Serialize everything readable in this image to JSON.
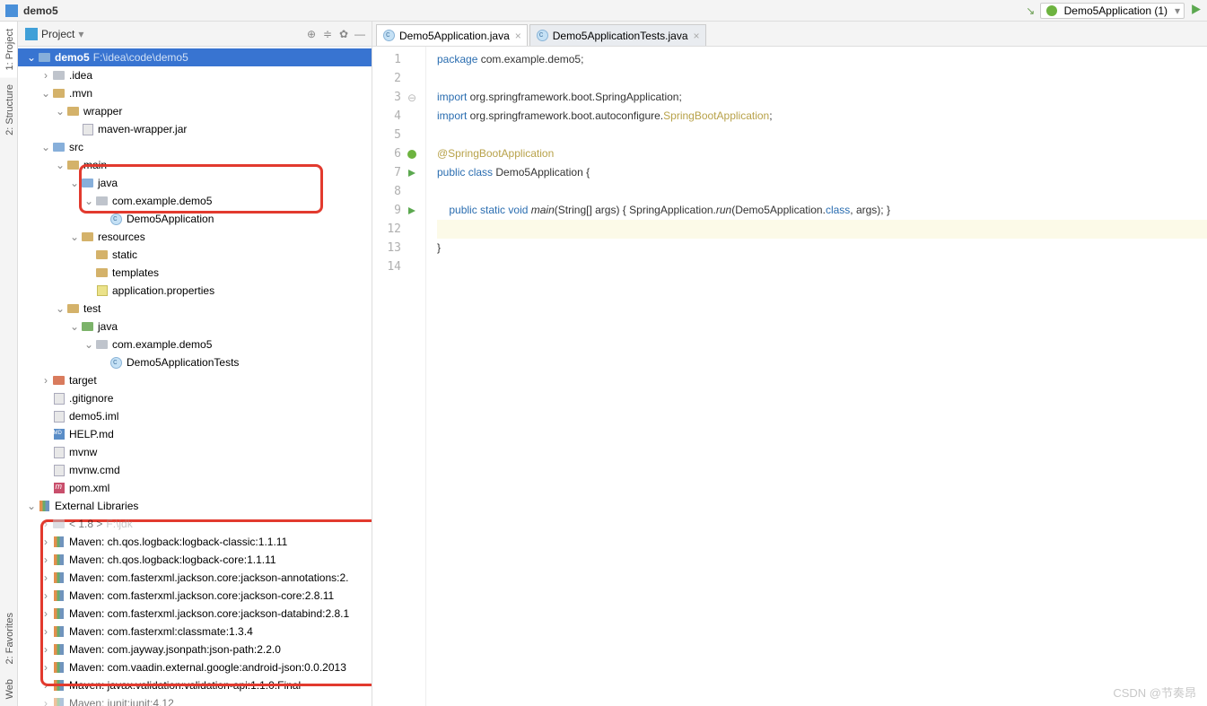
{
  "title": "demo5",
  "runConfig": "Demo5Application (1)",
  "panel": {
    "label": "Project"
  },
  "tabs": [
    {
      "label": "Demo5Application.java",
      "active": true
    },
    {
      "label": "Demo5ApplicationTests.java",
      "active": false
    }
  ],
  "sideTabs": [
    "1: Project",
    "2: Structure",
    "2: Favorites",
    "Web"
  ],
  "tree": [
    {
      "d": 0,
      "tw": "v",
      "ico": "folder-open",
      "label": "demo5",
      "suffix": "F:\\idea\\code\\demo5",
      "sel": true,
      "bold": true
    },
    {
      "d": 1,
      "tw": ">",
      "ico": "folder-grey",
      "label": ".idea"
    },
    {
      "d": 1,
      "tw": "v",
      "ico": "folder",
      "label": ".mvn"
    },
    {
      "d": 2,
      "tw": "v",
      "ico": "folder",
      "label": "wrapper"
    },
    {
      "d": 3,
      "tw": "",
      "ico": "file",
      "label": "maven-wrapper.jar"
    },
    {
      "d": 1,
      "tw": "v",
      "ico": "folder-open",
      "label": "src"
    },
    {
      "d": 2,
      "tw": "v",
      "ico": "folder",
      "label": "main"
    },
    {
      "d": 3,
      "tw": "v",
      "ico": "folder-open",
      "label": "java"
    },
    {
      "d": 4,
      "tw": "v",
      "ico": "folder-grey",
      "label": "com.example.demo5"
    },
    {
      "d": 5,
      "tw": "",
      "ico": "class",
      "label": "Demo5Application"
    },
    {
      "d": 3,
      "tw": "v",
      "ico": "folder",
      "label": "resources"
    },
    {
      "d": 4,
      "tw": "",
      "ico": "folder",
      "label": "static"
    },
    {
      "d": 4,
      "tw": "",
      "ico": "folder",
      "label": "templates"
    },
    {
      "d": 4,
      "tw": "",
      "ico": "props",
      "label": "application.properties"
    },
    {
      "d": 2,
      "tw": "v",
      "ico": "folder",
      "label": "test"
    },
    {
      "d": 3,
      "tw": "v",
      "ico": "folder-green",
      "label": "java"
    },
    {
      "d": 4,
      "tw": "v",
      "ico": "folder-grey",
      "label": "com.example.demo5"
    },
    {
      "d": 5,
      "tw": "",
      "ico": "class",
      "label": "Demo5ApplicationTests"
    },
    {
      "d": 1,
      "tw": ">",
      "ico": "folder-red",
      "label": "target"
    },
    {
      "d": 1,
      "tw": "",
      "ico": "file",
      "label": ".gitignore"
    },
    {
      "d": 1,
      "tw": "",
      "ico": "file",
      "label": "demo5.iml"
    },
    {
      "d": 1,
      "tw": "",
      "ico": "md",
      "label": "HELP.md"
    },
    {
      "d": 1,
      "tw": "",
      "ico": "file",
      "label": "mvnw"
    },
    {
      "d": 1,
      "tw": "",
      "ico": "file",
      "label": "mvnw.cmd"
    },
    {
      "d": 1,
      "tw": "",
      "ico": "maven",
      "label": "pom.xml"
    },
    {
      "d": 0,
      "tw": "v",
      "ico": "lib",
      "label": "External Libraries"
    },
    {
      "d": 1,
      "tw": ">",
      "ico": "folder-grey",
      "label": "< 1.8 >",
      "suffix": "F:\\jdk",
      "dim": true
    },
    {
      "d": 1,
      "tw": ">",
      "ico": "lib",
      "label": "Maven: ch.qos.logback:logback-classic:1.1.11"
    },
    {
      "d": 1,
      "tw": ">",
      "ico": "lib",
      "label": "Maven: ch.qos.logback:logback-core:1.1.11"
    },
    {
      "d": 1,
      "tw": ">",
      "ico": "lib",
      "label": "Maven: com.fasterxml.jackson.core:jackson-annotations:2."
    },
    {
      "d": 1,
      "tw": ">",
      "ico": "lib",
      "label": "Maven: com.fasterxml.jackson.core:jackson-core:2.8.11"
    },
    {
      "d": 1,
      "tw": ">",
      "ico": "lib",
      "label": "Maven: com.fasterxml.jackson.core:jackson-databind:2.8.1"
    },
    {
      "d": 1,
      "tw": ">",
      "ico": "lib",
      "label": "Maven: com.fasterxml:classmate:1.3.4"
    },
    {
      "d": 1,
      "tw": ">",
      "ico": "lib",
      "label": "Maven: com.jayway.jsonpath:json-path:2.2.0"
    },
    {
      "d": 1,
      "tw": ">",
      "ico": "lib",
      "label": "Maven: com.vaadin.external.google:android-json:0.0.2013"
    },
    {
      "d": 1,
      "tw": ">",
      "ico": "lib",
      "label": "Maven: javax.validation:validation-api:1.1.0.Final"
    },
    {
      "d": 1,
      "tw": ">",
      "ico": "lib",
      "label": "Maven: junit:junit:4.12",
      "dim": true
    }
  ],
  "code": {
    "lines": [
      {
        "n": 1,
        "html": "<span class='kw'>package</span> com.example.demo5;"
      },
      {
        "n": 2,
        "html": ""
      },
      {
        "n": 3,
        "html": "<span class='kw'>import</span> org.springframework.boot.SpringApplication;",
        "fold": true
      },
      {
        "n": 4,
        "html": "<span class='kw'>import</span> org.springframework.boot.autoconfigure.<span class='imp-cls'>SpringBootApplication</span>;"
      },
      {
        "n": 5,
        "html": ""
      },
      {
        "n": 6,
        "html": "<span class='ann'>@SpringBootApplication</span>",
        "icon": "spring"
      },
      {
        "n": 7,
        "html": "<span class='kw'>public</span> <span class='kw'>class</span> Demo5Application {",
        "icon": "run"
      },
      {
        "n": 8,
        "html": ""
      },
      {
        "n": 9,
        "html": "    <span class='kw'>public</span> <span class='kw'>static</span> <span class='kw'>void</span> <span class='mth'>main</span>(String[] args) { SpringApplication.<span class='mth'>run</span>(Demo5Application.<span class='kw'>class</span>, args); }",
        "icon": "run"
      },
      {
        "n": 12,
        "html": "",
        "caret": true
      },
      {
        "n": 13,
        "html": "}"
      },
      {
        "n": 14,
        "html": ""
      }
    ]
  },
  "watermark": "CSDN @节奏昂"
}
